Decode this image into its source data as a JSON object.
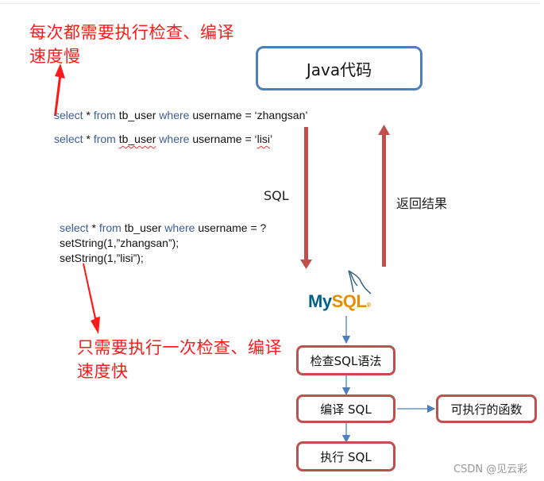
{
  "notes": {
    "slow_line1": "每次都需要执行检查、编译",
    "slow_line2": "速度慢",
    "fast_line1": "只需要执行一次检查、编译",
    "fast_line2": "速度快"
  },
  "statements": {
    "query1": {
      "kw1": "select",
      "star": " * ",
      "kw2": "from",
      "table": " tb_user ",
      "kw3": "where",
      "rest": " username = ‘zhangsan’"
    },
    "query2": {
      "kw1": "select",
      "star": " * ",
      "kw2": "from",
      "table_prefix": " ",
      "table": "tb_user",
      "table_suffix": " ",
      "kw3": "where",
      "rest_prefix": " username = ‘",
      "value": "lisi",
      "rest_suffix": "’"
    },
    "prepared": {
      "kw1": "select",
      "star": " * ",
      "kw2": "from",
      "table": " tb_user ",
      "kw3": "where",
      "rest": " username = ?"
    },
    "set1": "setString(1,”zhangsan”);",
    "set2": "setString(1,”lisi”);"
  },
  "java_box": "Java代码",
  "sql_label": "SQL",
  "return_label": "返回结果",
  "mysql_logo": {
    "my": "My",
    "sql": "SQL",
    "reg": "®"
  },
  "flow": {
    "check": "检查SQL语法",
    "compile": "编译 SQL",
    "executable": "可执行的函数",
    "execute": "执行 SQL"
  },
  "colors": {
    "annotation_red": "#ff1a1a",
    "keyword_blue": "#3b5d9a",
    "java_box_border": "#4f7fb8",
    "flow_box_border": "#c0504d",
    "flow_arrow": "#4f7fb8",
    "main_arrow": "#c0504d"
  },
  "watermark": "CSDN @见云彩"
}
